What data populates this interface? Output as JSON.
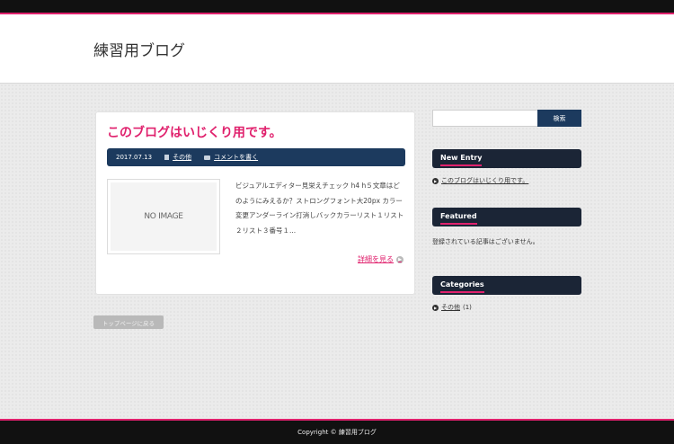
{
  "header": {
    "site_title": "練習用ブログ"
  },
  "post": {
    "title": "このブログはいじくり用です。",
    "date": "2017.07.13",
    "category": "その他",
    "comment_link": "コメントを書く",
    "thumbnail_text": "NO IMAGE",
    "excerpt": "ビジュアルエディター見栄えチェック h4 h５文章はどのようにみえるか？ストロングフォント大20px カラー変更アンダーライン打消しバックカラーリスト１リスト２リスト３番号１...",
    "read_more": "詳細を見る"
  },
  "nav": {
    "top_page_button": "トップページに戻る"
  },
  "sidebar": {
    "search_placeholder": "",
    "search_button": "検索",
    "new_entry": {
      "heading": "New Entry",
      "item": "このブログはいじくり用です。"
    },
    "featured": {
      "heading": "Featured",
      "empty_text": "登録されている記事はございません。"
    },
    "categories": {
      "heading": "Categories",
      "item": "その他",
      "count": "(1)"
    }
  },
  "footer": {
    "copyright": "Copyright ©  練習用ブログ"
  },
  "colors": {
    "accent": "#e0216d",
    "navy": "#1c3a5e",
    "widget": "#1b2536"
  }
}
